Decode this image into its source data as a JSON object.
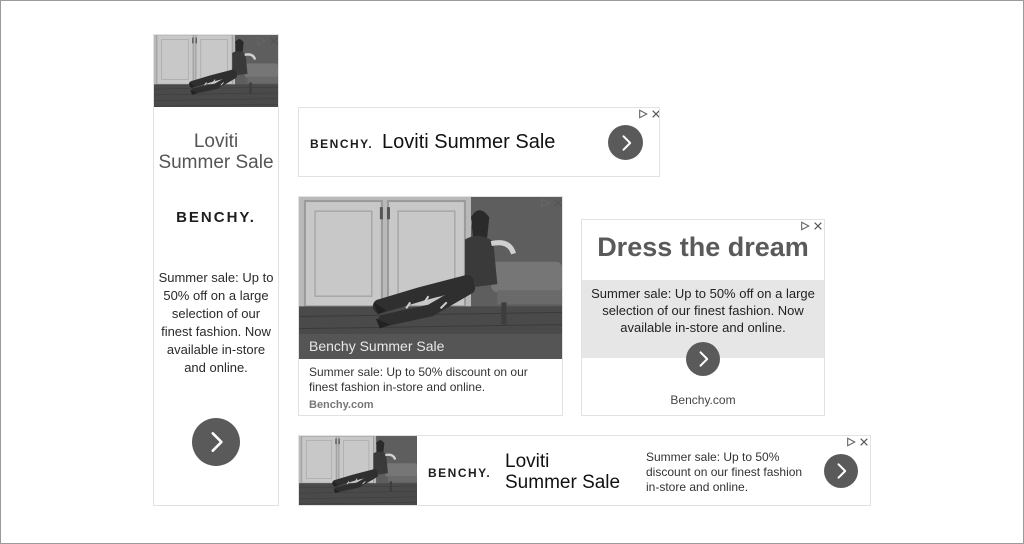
{
  "ads": {
    "skyscraper": {
      "title_line1": "Loviti",
      "title_line2": "Summer Sale",
      "brand": "BENCHY.",
      "body": "Summer sale: Up to 50% off on a large selection of our finest  fashion. Now available in-store and online."
    },
    "leaderboard_top": {
      "brand": "BENCHY.",
      "title": "Loviti Summer Sale"
    },
    "medium_rect": {
      "caption": "Benchy Summer Sale",
      "body": "Summer sale: Up to 50% discount on our finest  fashion in-store and online.",
      "url": "Benchy.com"
    },
    "text_rect": {
      "headline": "Dress the dream",
      "body": "Summer sale: Up to 50% off on a large selection of our  finest  fashion. Now available in-store and online.",
      "url": "Benchy.com"
    },
    "leaderboard_bottom": {
      "brand": "BENCHY.",
      "title_line1": "Loviti",
      "title_line2": "Summer Sale",
      "body": "Summer sale: Up to 50% discount on our  finest fashion in-store and online."
    }
  },
  "icons": {
    "adchoices": "adchoices-icon",
    "close": "close-icon",
    "next": "chevron-right-icon"
  }
}
